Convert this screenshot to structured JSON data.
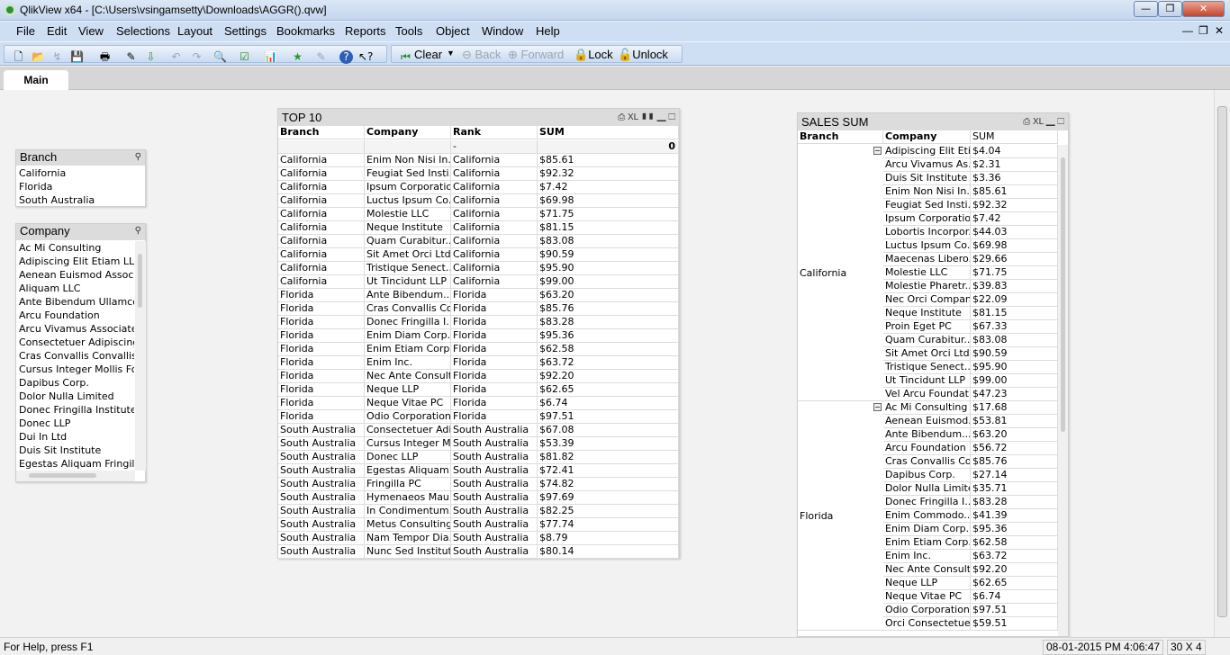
{
  "window": {
    "title": "QlikView x64 - [C:\\Users\\vsingamsetty\\Downloads\\AGGR().qvw]",
    "minimize": "—",
    "restore": "❐",
    "close": "✕"
  },
  "menu": [
    "File",
    "Edit",
    "View",
    "Selections",
    "Layout",
    "Settings",
    "Bookmarks",
    "Reports",
    "Tools",
    "Object",
    "Window",
    "Help"
  ],
  "toolbar": {
    "clear": "Clear",
    "back": "Back",
    "forward": "Forward",
    "lock": "Lock",
    "unlock": "Unlock"
  },
  "tabs": [
    {
      "label": "Main",
      "active": true
    }
  ],
  "branch_listbox": {
    "title": "Branch",
    "items": [
      "California",
      "Florida",
      "South Australia"
    ]
  },
  "company_listbox": {
    "title": "Company",
    "items": [
      "Ac Mi Consulting",
      "Adipiscing Elit Etiam LLC",
      "Aenean Euismod Associate",
      "Aliquam LLC",
      "Ante Bibendum Ullamcorper",
      "Arcu Foundation",
      "Arcu Vivamus Associates",
      "Consectetuer Adipiscing Lt",
      "Cras Convallis Convallis Co",
      "Cursus Integer Mollis Foun",
      "Dapibus Corp.",
      "Dolor Nulla Limited",
      "Donec Fringilla Institute",
      "Donec LLP",
      "Dui In Ltd",
      "Duis Sit Institute",
      "Egestas Aliquam Fringilla Fo"
    ]
  },
  "top10": {
    "title": "TOP 10",
    "icons": {
      "print": "⎙",
      "xl": "XL"
    },
    "columns": [
      "Branch",
      "Company",
      "Rank",
      "SUM"
    ],
    "totals": [
      "",
      "",
      "-",
      "0"
    ],
    "rows": [
      [
        "California",
        "Enim Non Nisi In...",
        "California",
        "$85.61"
      ],
      [
        "California",
        "Feugiat Sed Insti...",
        "California",
        "$92.32"
      ],
      [
        "California",
        "Ipsum Corporation",
        "California",
        "$7.42"
      ],
      [
        "California",
        "Luctus Ipsum Co...",
        "California",
        "$69.98"
      ],
      [
        "California",
        "Molestie LLC",
        "California",
        "$71.75"
      ],
      [
        "California",
        "Neque Institute",
        "California",
        "$81.15"
      ],
      [
        "California",
        "Quam Curabitur...",
        "California",
        "$83.08"
      ],
      [
        "California",
        "Sit Amet Orci Ltd",
        "California",
        "$90.59"
      ],
      [
        "California",
        "Tristique Senect...",
        "California",
        "$95.90"
      ],
      [
        "California",
        "Ut Tincidunt LLP",
        "California",
        "$99.00"
      ],
      [
        "Florida",
        "Ante Bibendum...",
        "Florida",
        "$63.20"
      ],
      [
        "Florida",
        "Cras Convallis Co...",
        "Florida",
        "$85.76"
      ],
      [
        "Florida",
        "Donec Fringilla I...",
        "Florida",
        "$83.28"
      ],
      [
        "Florida",
        "Enim Diam Corp...",
        "Florida",
        "$95.36"
      ],
      [
        "Florida",
        "Enim Etiam Corp...",
        "Florida",
        "$62.58"
      ],
      [
        "Florida",
        "Enim Inc.",
        "Florida",
        "$63.72"
      ],
      [
        "Florida",
        "Nec Ante Consult...",
        "Florida",
        "$92.20"
      ],
      [
        "Florida",
        "Neque LLP",
        "Florida",
        "$62.65"
      ],
      [
        "Florida",
        "Neque Vitae PC",
        "Florida",
        "$6.74"
      ],
      [
        "Florida",
        "Odio Corporation",
        "Florida",
        "$97.51"
      ],
      [
        "South Australia",
        "Consectetuer Adi...",
        "South Australia",
        "$67.08"
      ],
      [
        "South Australia",
        "Cursus Integer M...",
        "South Australia",
        "$53.39"
      ],
      [
        "South Australia",
        "Donec LLP",
        "South Australia",
        "$81.82"
      ],
      [
        "South Australia",
        "Egestas Aliquam...",
        "South Australia",
        "$72.41"
      ],
      [
        "South Australia",
        "Fringilla PC",
        "South Australia",
        "$74.82"
      ],
      [
        "South Australia",
        "Hymenaeos Mau...",
        "South Australia",
        "$97.69"
      ],
      [
        "South Australia",
        "In Condimentum...",
        "South Australia",
        "$82.25"
      ],
      [
        "South Australia",
        "Metus Consulting",
        "South Australia",
        "$77.74"
      ],
      [
        "South Australia",
        "Nam Tempor Dia...",
        "South Australia",
        "$8.79"
      ],
      [
        "South Australia",
        "Nunc Sed Institute",
        "South Australia",
        "$80.14"
      ]
    ]
  },
  "sales_sum": {
    "title": "SALES SUM",
    "icons": {
      "print": "⎙",
      "xl": "XL"
    },
    "columns": [
      "Branch",
      "Company",
      "SUM"
    ],
    "groups": [
      {
        "branch": "California",
        "rows": [
          [
            "Adipiscing Elit Eti...",
            "$4.04"
          ],
          [
            "Arcu Vivamus As...",
            "$2.31"
          ],
          [
            "Duis Sit Institute",
            "$3.36"
          ],
          [
            "Enim Non Nisi In...",
            "$85.61"
          ],
          [
            "Feugiat Sed Insti...",
            "$92.32"
          ],
          [
            "Ipsum Corporation",
            "$7.42"
          ],
          [
            "Lobortis Incorpor...",
            "$44.03"
          ],
          [
            "Luctus Ipsum Co...",
            "$69.98"
          ],
          [
            "Maecenas Libero...",
            "$29.66"
          ],
          [
            "Molestie LLC",
            "$71.75"
          ],
          [
            "Molestie Pharetr...",
            "$39.83"
          ],
          [
            "Nec Orci Company",
            "$22.09"
          ],
          [
            "Neque Institute",
            "$81.15"
          ],
          [
            "Proin Eget PC",
            "$67.33"
          ],
          [
            "Quam Curabitur...",
            "$83.08"
          ],
          [
            "Sit Amet Orci Ltd",
            "$90.59"
          ],
          [
            "Tristique Senect...",
            "$95.90"
          ],
          [
            "Ut Tincidunt LLP",
            "$99.00"
          ],
          [
            "Vel Arcu Foundat...",
            "$47.23"
          ]
        ]
      },
      {
        "branch": "Florida",
        "rows": [
          [
            "Ac Mi Consulting",
            "$17.68"
          ],
          [
            "Aenean Euismod...",
            "$53.81"
          ],
          [
            "Ante Bibendum...",
            "$63.20"
          ],
          [
            "Arcu Foundation",
            "$56.72"
          ],
          [
            "Cras Convallis Co...",
            "$85.76"
          ],
          [
            "Dapibus Corp.",
            "$27.14"
          ],
          [
            "Dolor Nulla Limited",
            "$35.71"
          ],
          [
            "Donec Fringilla I...",
            "$83.28"
          ],
          [
            "Enim Commodo...",
            "$41.39"
          ],
          [
            "Enim Diam Corp...",
            "$95.36"
          ],
          [
            "Enim Etiam Corp...",
            "$62.58"
          ],
          [
            "Enim Inc.",
            "$63.72"
          ],
          [
            "Nec Ante Consult...",
            "$92.20"
          ],
          [
            "Neque LLP",
            "$62.65"
          ],
          [
            "Neque Vitae PC",
            "$6.74"
          ],
          [
            "Odio Corporation",
            "$97.51"
          ],
          [
            "Orci Consectetue...",
            "$59.51"
          ]
        ]
      }
    ]
  },
  "status": {
    "help": "For Help, press F1",
    "datetime": "08-01-2015 PM 4:06:47",
    "dims": "30 X 4"
  }
}
